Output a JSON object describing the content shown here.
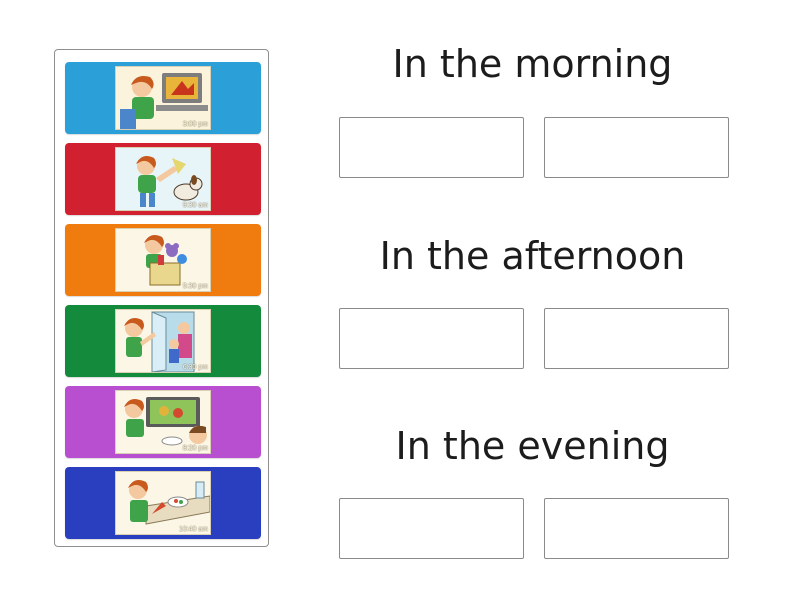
{
  "cards": [
    {
      "time": "3:00 pm",
      "color": "#2a9fd8",
      "scene": "girl at computer"
    },
    {
      "time": "9:30 am",
      "color": "#d1202f",
      "scene": "girl playing with dog"
    },
    {
      "time": "5:30 pm",
      "color": "#f07c10",
      "scene": "girl packing toys"
    },
    {
      "time": "6:30 pm",
      "color": "#148a3c",
      "scene": "girl greeting family at door"
    },
    {
      "time": "8:20 pm",
      "color": "#b84fd0",
      "scene": "girl watching tv"
    },
    {
      "time": "10:40 am",
      "color": "#2a3fbf",
      "scene": "girl eating at table"
    }
  ],
  "groups": [
    {
      "label": "In the morning"
    },
    {
      "label": "In the afternoon"
    },
    {
      "label": "In the evening"
    }
  ]
}
